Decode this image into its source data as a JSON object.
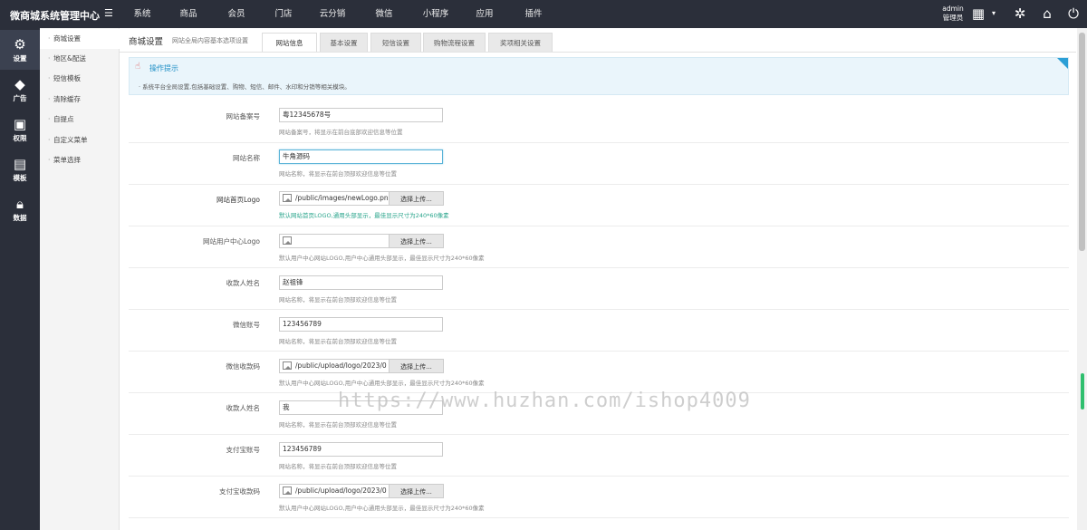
{
  "brand": "微商城系统管理中心",
  "topnav": [
    "系统",
    "商品",
    "会员",
    "门店",
    "云分销",
    "微信",
    "小程序",
    "应用",
    "插件"
  ],
  "admin": {
    "name": "admin",
    "role": "管理员"
  },
  "rail": [
    {
      "label": "设置",
      "icon": "gear-icon"
    },
    {
      "label": "广告",
      "icon": "diamond-icon"
    },
    {
      "label": "权限",
      "icon": "ad-icon"
    },
    {
      "label": "模板",
      "icon": "document-icon"
    },
    {
      "label": "数据",
      "icon": "lock-icon"
    }
  ],
  "submenu": [
    "商城设置",
    "地区&配送",
    "短信模板",
    "清除缓存",
    "自提点",
    "自定义菜单",
    "菜单选择"
  ],
  "header": {
    "title": "商城设置",
    "subtitle": "网站全局内容基本选项设置"
  },
  "tabs": [
    "网站信息",
    "基本设置",
    "短信设置",
    "购物流程设置",
    "奖项相关设置"
  ],
  "tip": {
    "title": "操作提示",
    "text": "系统平台全局设置,包括基础设置、购物、短信、邮件、水印和分销等相关模块。"
  },
  "form": [
    {
      "label": "网站备案号",
      "type": "text",
      "value": "粤12345678号",
      "hint": "网站备案号，将显示在前台底部欢迎信息等位置"
    },
    {
      "label": "网站名称",
      "type": "text",
      "value": "牛角源码",
      "hint": "网站名称，将显示在前台顶部欢迎信息等位置"
    },
    {
      "label": "网站首页Logo",
      "type": "file",
      "value": "/public/images/newLogo.pn",
      "button": "选择上传...",
      "hint": "默认网站首页LOGO,通用头部显示，最佳显示尺寸为240*60像素"
    },
    {
      "label": "网站用户中心Logo",
      "type": "file",
      "value": "",
      "button": "选择上传...",
      "hint": "默认用户中心网站LOGO,用户中心通用头部显示，最佳显示尺寸为240*60像素"
    },
    {
      "label": "收款人姓名",
      "type": "text",
      "value": "赵祖锋",
      "hint": "网站名称，将显示在前台顶部欢迎信息等位置"
    },
    {
      "label": "微信账号",
      "type": "text",
      "value": "123456789",
      "hint": "网站名称，将显示在前台顶部欢迎信息等位置"
    },
    {
      "label": "微信收款码",
      "type": "file",
      "value": "/public/upload/logo/2023/0",
      "button": "选择上传...",
      "hint": "默认用户中心网站LOGO,用户中心通用头部显示，最佳显示尺寸为240*60像素"
    },
    {
      "label": "收款人姓名",
      "type": "text",
      "value": "我",
      "hint": "网站名称，将显示在前台顶部欢迎信息等位置"
    },
    {
      "label": "支付宝账号",
      "type": "text",
      "value": "123456789",
      "hint": "网站名称，将显示在前台顶部欢迎信息等位置"
    },
    {
      "label": "支付宝收款码",
      "type": "file",
      "value": "/public/upload/logo/2023/0",
      "button": "选择上传...",
      "hint": "默认用户中心网站LOGO,用户中心通用头部显示，最佳显示尺寸为240*60像素"
    }
  ],
  "watermark": "https://www.huzhan.com/ishop4009"
}
